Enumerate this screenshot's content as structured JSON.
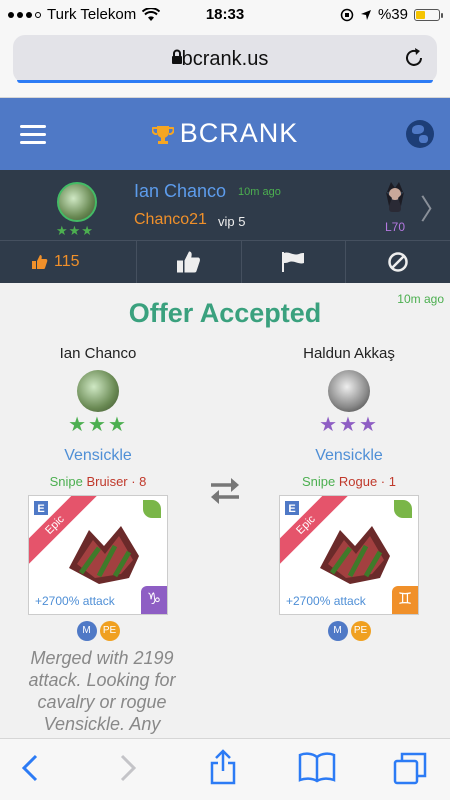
{
  "status_bar": {
    "carrier": "Turk Telekom",
    "time": "18:33",
    "battery": "%39",
    "battery_level": 0.39
  },
  "browser": {
    "host": "bcrank.us"
  },
  "app": {
    "brand": "BCRANK"
  },
  "profile": {
    "name": "Ian Chanco",
    "posted_ago": "10m ago",
    "nickname": "Chanco21",
    "vip": "vip 5",
    "stars": "★★★",
    "level": "L70"
  },
  "actions": {
    "likes": "115"
  },
  "offer": {
    "ago": "10m ago",
    "title": "Offer Accepted",
    "left": {
      "player": "Ian Chanco",
      "stars": "★★★",
      "hero": "Vensickle",
      "tag1": "Snipe",
      "tag2": "Bruiser · 8",
      "rarity": "Epic",
      "bonus": "+2700% attack",
      "class_symbol": "♑",
      "badge1": "M",
      "badge2": "PE"
    },
    "right": {
      "player": "Haldun Akkaş",
      "stars": "★★★",
      "hero": "Vensickle",
      "tag1": "Snipe",
      "tag2": "Rogue · 1",
      "rarity": "Epic",
      "bonus": "+2700% attack",
      "class_symbol": "♊",
      "badge1": "M",
      "badge2": "PE"
    },
    "note": "Merged with 2199 attack. Looking for cavalry or rogue Vensickle. Any"
  },
  "colors": {
    "header": "#4f79c6",
    "profile_bg": "#2f3b4a",
    "accent_green": "#3aa17e",
    "accent_orange": "#f0902a"
  }
}
